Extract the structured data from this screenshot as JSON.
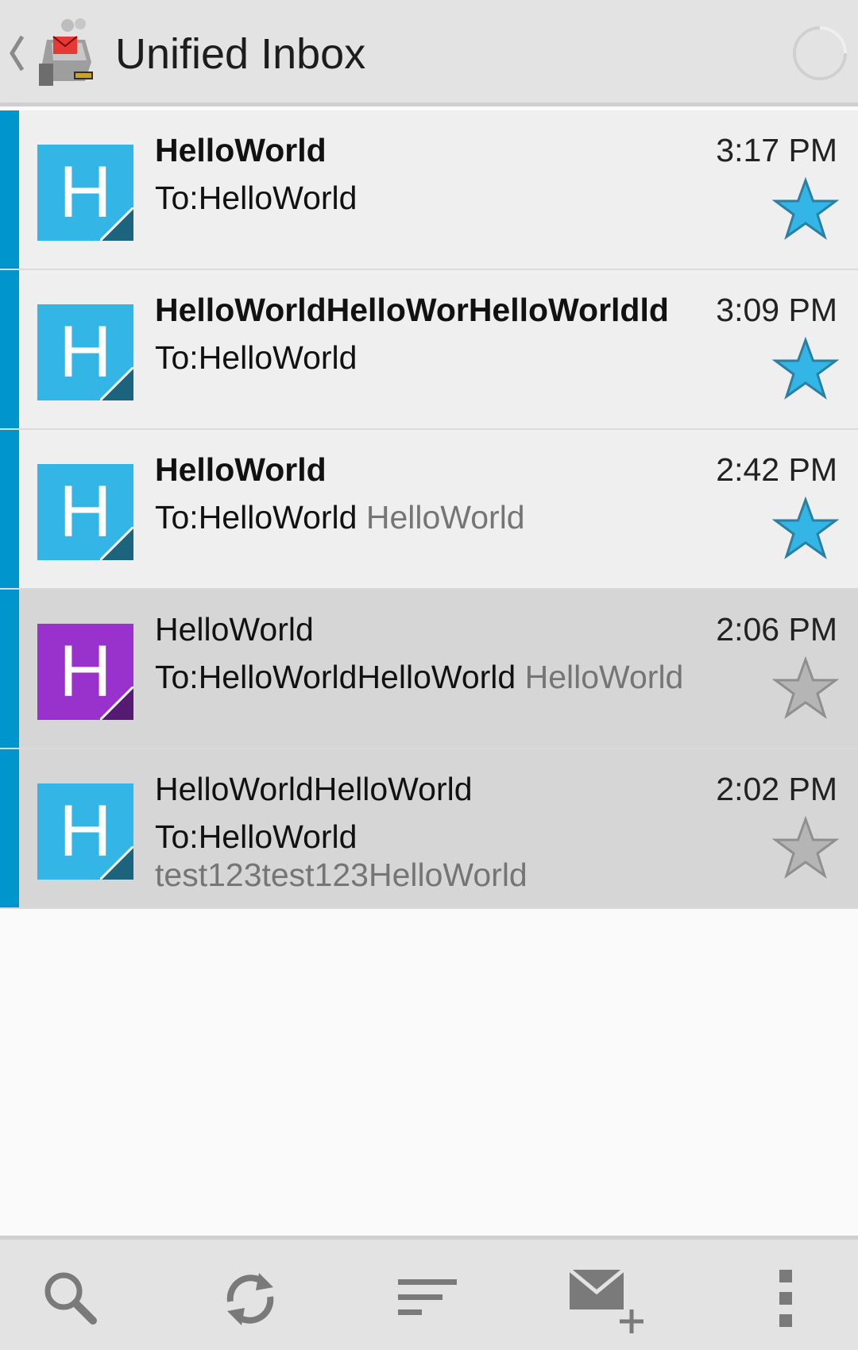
{
  "header": {
    "title": "Unified Inbox",
    "back_icon": "chevron-left-icon",
    "logo_icon": "k9-mail-logo-icon",
    "progress_icon": "loading-spinner-icon"
  },
  "messages": [
    {
      "avatar_letter": "H",
      "avatar_color": "#33b5e5",
      "sender": "HelloWorld",
      "time": "3:17 PM",
      "to": "To:HelloWorld",
      "preview_inline": "",
      "preview_line": "",
      "starred": true,
      "unread": true
    },
    {
      "avatar_letter": "H",
      "avatar_color": "#33b5e5",
      "sender": "HelloWorldHelloWorHelloWorldld",
      "time": "3:09 PM",
      "to": "To:HelloWorld",
      "preview_inline": "",
      "preview_line": "",
      "starred": true,
      "unread": true
    },
    {
      "avatar_letter": "H",
      "avatar_color": "#33b5e5",
      "sender": "HelloWorld",
      "time": "2:42 PM",
      "to": "To:HelloWorld",
      "preview_inline": "HelloWorld",
      "preview_line": "",
      "starred": true,
      "unread": true
    },
    {
      "avatar_letter": "H",
      "avatar_color": "#9932cc",
      "sender": "HelloWorld",
      "time": "2:06 PM",
      "to": "To:HelloWorldHelloWorld",
      "preview_inline": "HelloWorld",
      "preview_line": "",
      "starred": false,
      "unread": false
    },
    {
      "avatar_letter": "H",
      "avatar_color": "#33b5e5",
      "sender": "HelloWorldHelloWorld",
      "time": "2:02 PM",
      "to": "To:HelloWorld",
      "preview_inline": "",
      "preview_line": "test123test123HelloWorld",
      "starred": false,
      "unread": false
    }
  ],
  "toolbar": {
    "buttons": [
      "search-icon",
      "refresh-icon",
      "sort-icon",
      "compose-icon",
      "overflow-menu-icon"
    ]
  },
  "colors": {
    "accent": "#0095cc",
    "star_on": "#33b5e5",
    "star_off": "#b5b5b5"
  }
}
